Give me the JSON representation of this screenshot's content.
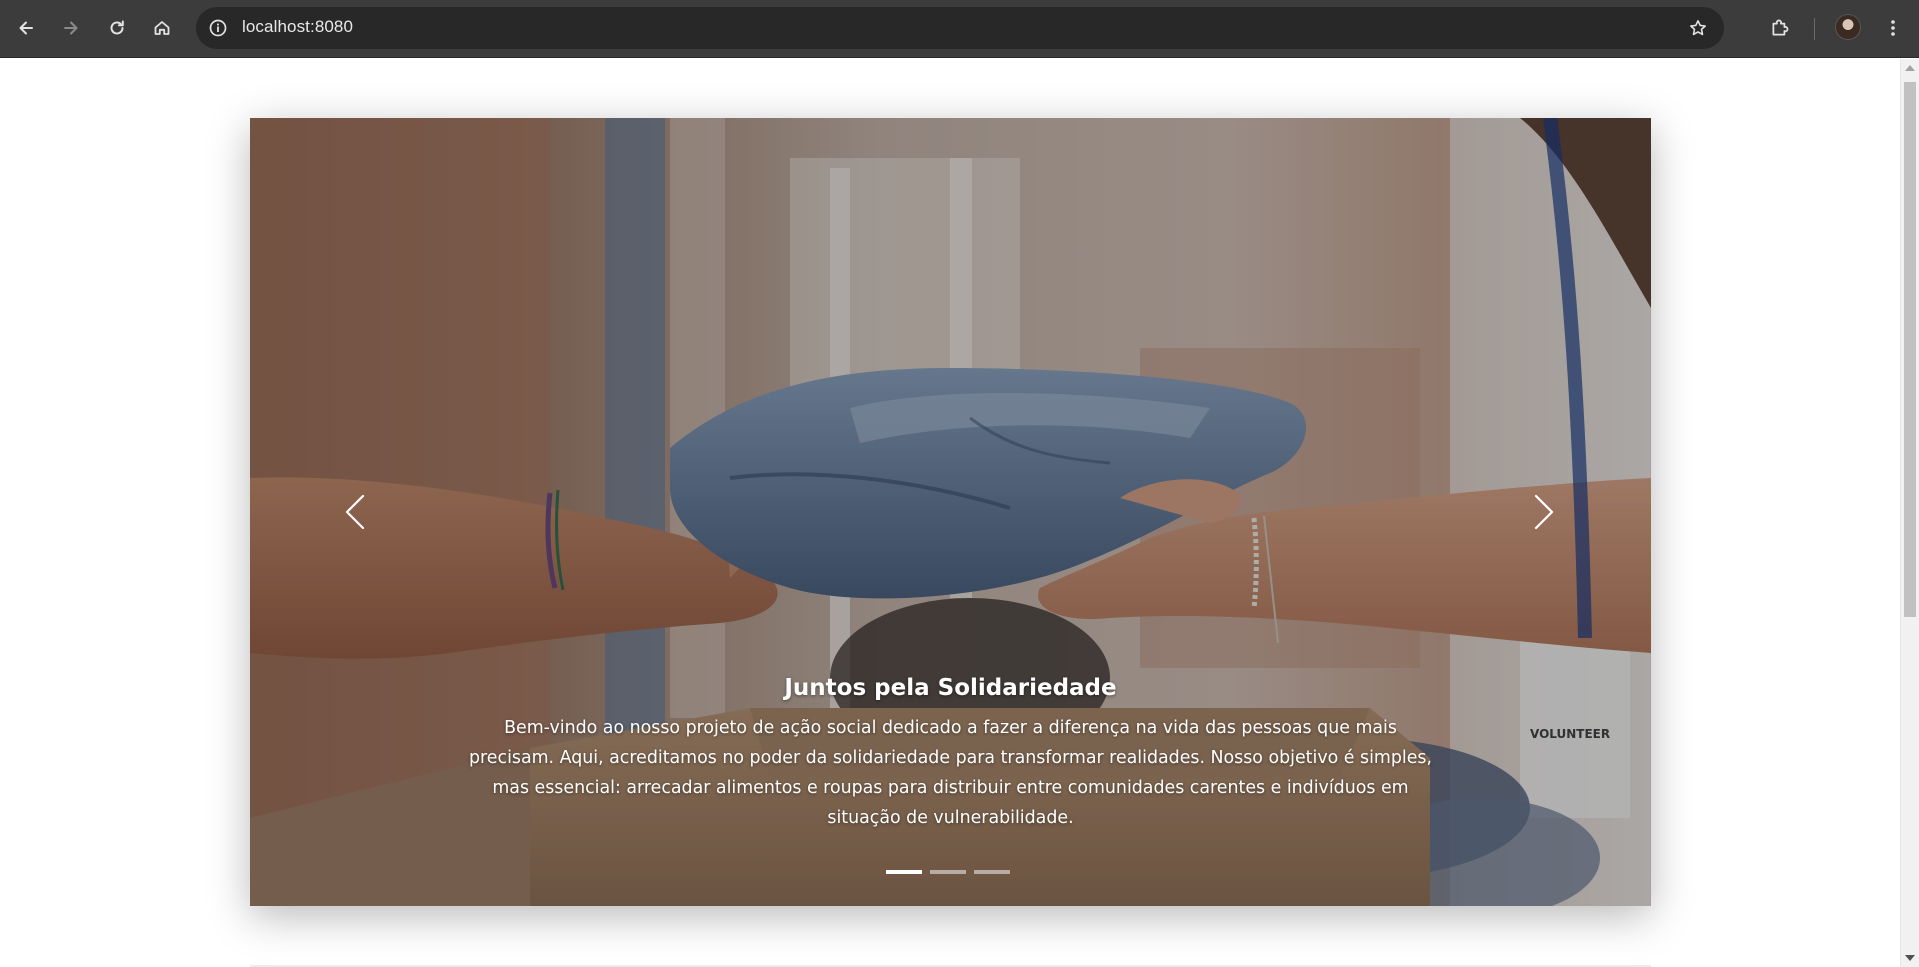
{
  "browser": {
    "url": "localhost:8080",
    "icons": {
      "back": "arrow-left-icon",
      "forward": "arrow-right-icon",
      "reload": "reload-icon",
      "home": "home-icon",
      "site_info": "info-icon",
      "bookmark": "star-icon",
      "extensions": "puzzle-icon",
      "menu": "kebab-menu-icon"
    }
  },
  "carousel": {
    "slides_count": 3,
    "active_index": 0,
    "caption": {
      "title": "Juntos pela Solidariedade",
      "text": "Bem-vindo ao nosso projeto de ação social dedicado a fazer a diferença na vida das pessoas que mais precisam. Aqui, acreditamos no poder da solidariedade para transformar realidades. Nosso objetivo é simples, mas essencial: arrecadar alimentos e roupas para distribuir entre comunidades carentes e indivíduos em situação de vulnerabilidade."
    },
    "image_sign_text": "VOLUNTEER"
  },
  "colors": {
    "chrome_bg": "#3c3c3c",
    "omnibox_bg": "#282828",
    "indicator_active": "#ffffff"
  }
}
